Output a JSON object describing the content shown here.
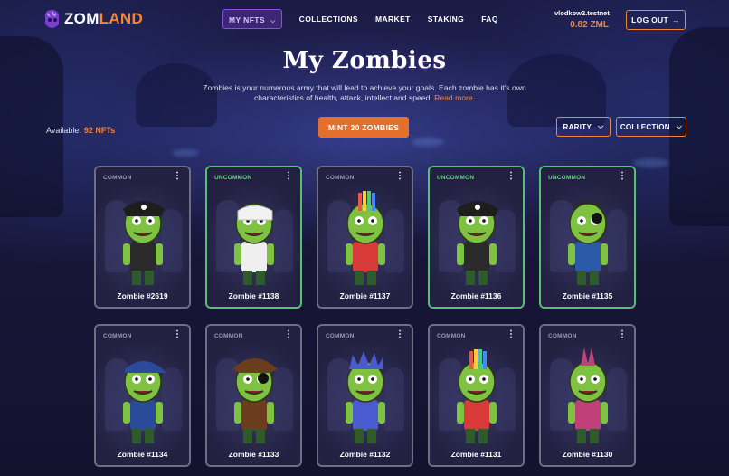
{
  "header": {
    "logo": {
      "part1": "ZOM",
      "part2": "LAND"
    },
    "nav": [
      {
        "label": "MY NFTS",
        "active": true
      },
      {
        "label": "COLLECTIONS",
        "active": false
      },
      {
        "label": "MARKET",
        "active": false
      },
      {
        "label": "STAKING",
        "active": false
      },
      {
        "label": "FAQ",
        "active": false
      }
    ],
    "account": {
      "name": "vlodkow2.testnet",
      "balance": "0.82 ZML"
    },
    "logout_label": "LOG OUT"
  },
  "hero": {
    "title": "My Zombies",
    "description": "Zombies is your numerous army that will lead to achieve your goals. Each zombie has it's own characteristics of health, attack, intellect and speed.",
    "read_more": "Read more."
  },
  "toolbar": {
    "available_label": "Available:",
    "available_count": "92 NFTs",
    "mint_label": "MINT 30 ZOMBIES",
    "filters": [
      "RARITY",
      "COLLECTION"
    ]
  },
  "cards": [
    {
      "rarity": "COMMON",
      "name": "Zombie #2619",
      "hat": "pirate",
      "accent": "#2a2a2a"
    },
    {
      "rarity": "UNCOMMON",
      "name": "Zombie #1138",
      "hat": "bandage",
      "accent": "#efefef"
    },
    {
      "rarity": "COMMON",
      "name": "Zombie #1137",
      "hat": "mohawk",
      "accent": "#d83a3a"
    },
    {
      "rarity": "UNCOMMON",
      "name": "Zombie #1136",
      "hat": "pirate",
      "accent": "#2a2a2a"
    },
    {
      "rarity": "UNCOMMON",
      "name": "Zombie #1135",
      "hat": "eyepatch",
      "accent": "#2a5aa8"
    },
    {
      "rarity": "COMMON",
      "name": "Zombie #1134",
      "hat": "cap",
      "accent": "#2c4a9a"
    },
    {
      "rarity": "COMMON",
      "name": "Zombie #1133",
      "hat": "tricorn",
      "accent": "#6b3d1e"
    },
    {
      "rarity": "COMMON",
      "name": "Zombie #1132",
      "hat": "spiky",
      "accent": "#4a5ad0"
    },
    {
      "rarity": "COMMON",
      "name": "Zombie #1131",
      "hat": "mohawk",
      "accent": "#d83a3a"
    },
    {
      "rarity": "COMMON",
      "name": "Zombie #1130",
      "hat": "punk",
      "accent": "#c0407a"
    }
  ],
  "colors": {
    "accent": "#f0863a",
    "uncommon": "#55c173",
    "common": "#6e6e86",
    "zombie_skin": "#7fc241"
  }
}
